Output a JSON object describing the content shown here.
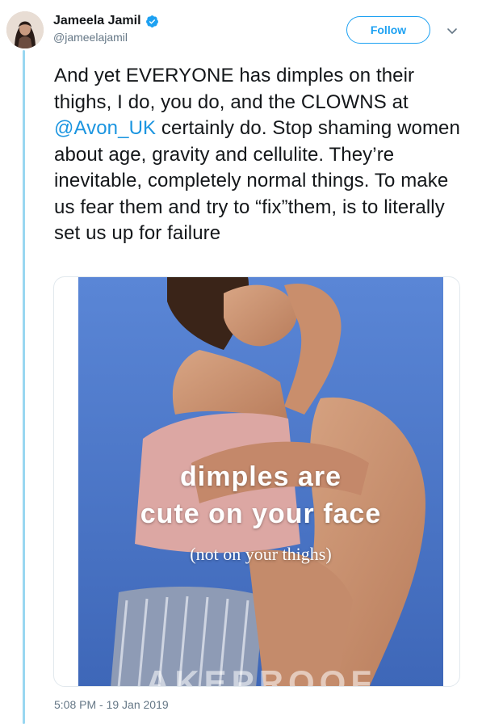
{
  "tweet": {
    "author": {
      "name": "Jameela Jamil",
      "handle": "@jameelajamil",
      "verified": true
    },
    "follow_label": "Follow",
    "text_segments": {
      "line1": "And yet EVERYONE has dimples on their thighs, I do, you do, and the CLOWNS at ",
      "mention": "@Avon_UK",
      "line2": " certainly do. Stop shaming women about age, gravity and cellulite. They’re inevitable, completely normal things. To make us fear them and try to “fix”them, is to literally set us up for failure"
    },
    "media": {
      "overlay_line1": "dimples are",
      "overlay_line2": "cute on your face",
      "overlay_line3": "(not on your thighs)",
      "watermark": "AKEPROOF"
    },
    "timestamp": "5:08 PM - 19 Jan 2019"
  },
  "colors": {
    "accent": "#1da1f2",
    "thread_line": "#99d7f1",
    "secondary_text": "#657786"
  },
  "icons": [
    "verified-badge-icon",
    "chevron-down-icon"
  ]
}
